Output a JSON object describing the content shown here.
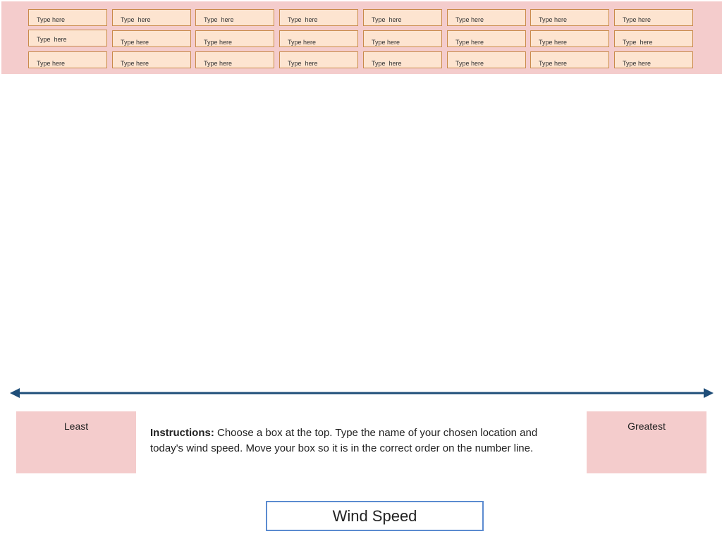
{
  "boxes": {
    "row1": [
      "Type here",
      "Type  here",
      "Type  here",
      "Type  here",
      "Type  here",
      "Type here",
      "Type here",
      "Type here"
    ],
    "row2": [
      "Type  here",
      "Type here",
      "Type here",
      "Type here",
      "Type here",
      "Type here",
      "Type here",
      "Type  here"
    ],
    "row3": [
      "Type here",
      "Type here",
      "Type here",
      "Type  here",
      "Type  here",
      "Type here",
      "Type here",
      "Type here"
    ]
  },
  "least_label": "Least",
  "greatest_label": "Greatest",
  "instructions": {
    "label": "Instructions:",
    "text": " Choose a box at the top. Type the name of your chosen location and today's wind speed. Move your box so it is in the correct order on the number line."
  },
  "title": "Wind Speed",
  "colors": {
    "band": "#f4cccc",
    "box_fill": "#fde4d0",
    "box_border": "#c98a4a",
    "number_line": "#1f4e79",
    "title_border": "#5b8bd0"
  }
}
